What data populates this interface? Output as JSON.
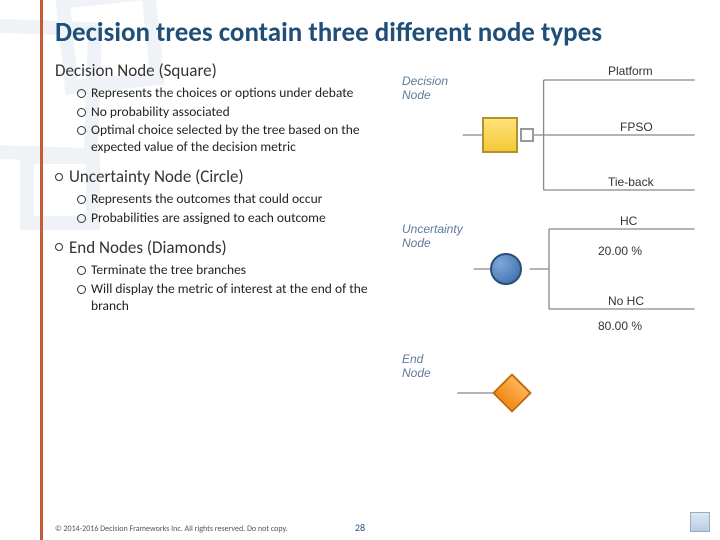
{
  "title": "Decision trees contain three different node types",
  "sections": [
    {
      "heading": "Decision Node (Square)",
      "showLeadBullet": false,
      "bullets": [
        "Represents the choices or options under debate",
        "No probability associated",
        "Optimal choice selected by the tree based on the expected value of the decision metric"
      ]
    },
    {
      "heading": "Uncertainty Node (Circle)",
      "showLeadBullet": true,
      "bullets": [
        "Represents the outcomes that could occur",
        "Probabilities are assigned to each outcome"
      ]
    },
    {
      "heading": "End Nodes (Diamonds)",
      "showLeadBullet": true,
      "bullets": [
        "Terminate the tree branches",
        "Will display the metric of interest at the end of the branch"
      ]
    }
  ],
  "diagrams": {
    "decision": {
      "label": "Decision\nNode",
      "branches": [
        "Platform",
        "FPSO",
        "Tie-back"
      ]
    },
    "uncertainty": {
      "label": "Uncertainty\nNode",
      "branches": [
        "HC",
        "No HC"
      ],
      "probs": [
        "20.00 %",
        "80.00 %"
      ]
    },
    "end": {
      "label": "End\nNode"
    }
  },
  "footer": "© 2014-2016 Decision Frameworks Inc. All rights reserved. Do not copy.",
  "page": "28"
}
